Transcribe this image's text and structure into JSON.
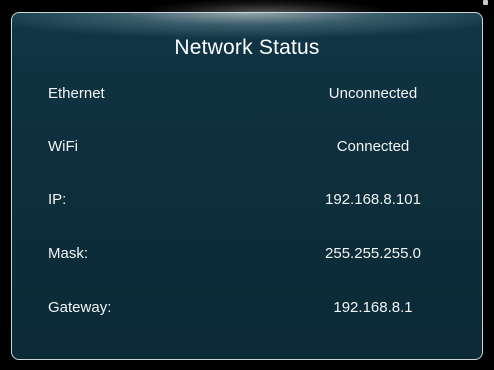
{
  "panel": {
    "title": "Network Status",
    "rows": [
      {
        "label": "Ethernet",
        "value": "Unconnected"
      },
      {
        "label": "WiFi",
        "value": "Connected"
      },
      {
        "label": "IP:",
        "value": "192.168.8.101"
      },
      {
        "label": "Mask:",
        "value": "255.255.255.0"
      },
      {
        "label": "Gateway:",
        "value": "192.168.8.1"
      }
    ]
  },
  "colors": {
    "panel_background": "#0f3241",
    "panel_border": "#c9d6dd",
    "text": "#ffffff"
  }
}
